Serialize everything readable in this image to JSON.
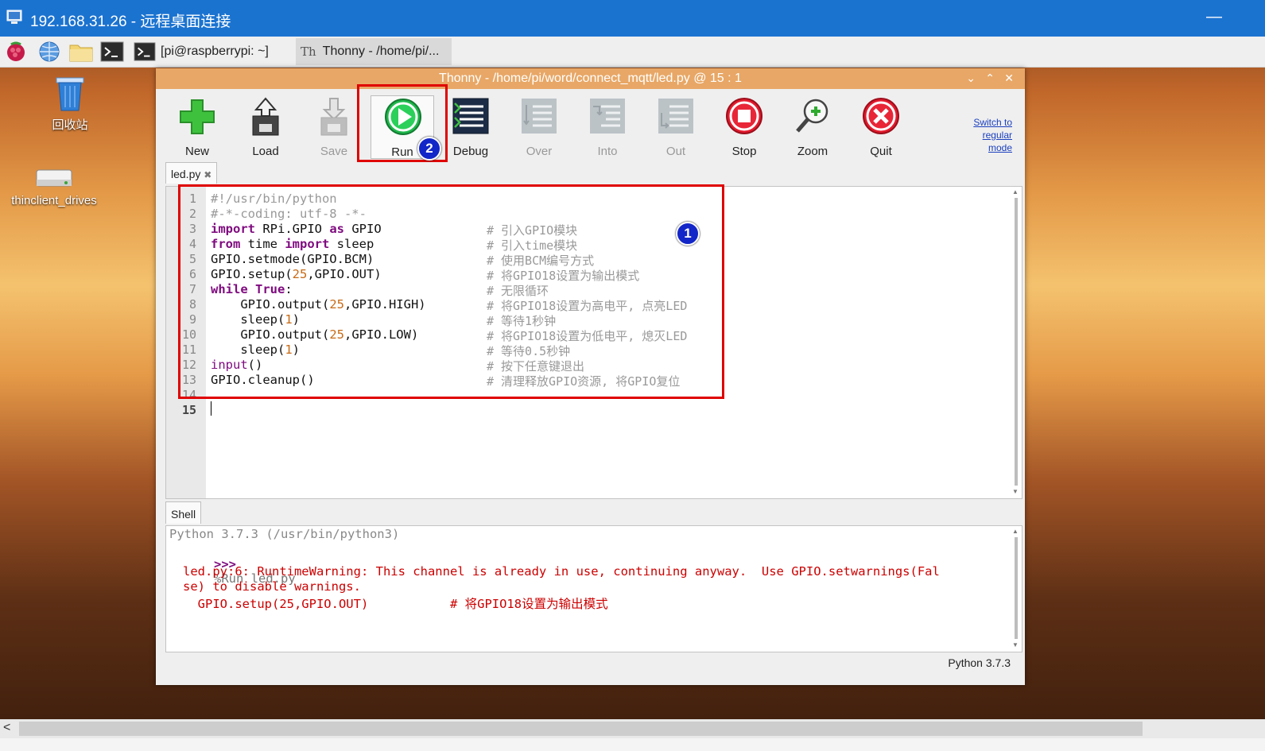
{
  "remote_window": {
    "title": "192.168.31.26 - 远程桌面连接",
    "minimize": "—"
  },
  "taskbar": {
    "terminal_task": "[pi@raspberrypi: ~]",
    "thonny_task": "Thonny  -  /home/pi/...",
    "icons": [
      "raspberry-menu-icon",
      "browser-icon",
      "file-manager-icon",
      "terminal-icon"
    ]
  },
  "desktop": {
    "icons": [
      {
        "name": "trash-icon",
        "label": "回收站"
      },
      {
        "name": "drive-icon",
        "label": "thinclient_drives"
      }
    ]
  },
  "thonny": {
    "title": "Thonny  -  /home/pi/word/connect_mqtt/led.py  @  15 : 1",
    "window_controls": [
      "⌄",
      "⌃",
      "✕"
    ],
    "toolbar": [
      {
        "id": "new",
        "label": "New",
        "enabled": true
      },
      {
        "id": "load",
        "label": "Load",
        "enabled": true
      },
      {
        "id": "save",
        "label": "Save",
        "enabled": false
      },
      {
        "id": "run",
        "label": "Run",
        "enabled": true
      },
      {
        "id": "debug",
        "label": "Debug",
        "enabled": true
      },
      {
        "id": "over",
        "label": "Over",
        "enabled": false
      },
      {
        "id": "into",
        "label": "Into",
        "enabled": false
      },
      {
        "id": "out",
        "label": "Out",
        "enabled": false
      },
      {
        "id": "stop",
        "label": "Stop",
        "enabled": true
      },
      {
        "id": "zoom",
        "label": "Zoom",
        "enabled": true
      },
      {
        "id": "quit",
        "label": "Quit",
        "enabled": true
      }
    ],
    "switch_mode": [
      "Switch to",
      "regular",
      "mode"
    ],
    "editor_tab": "led.py",
    "editor_tab_close": "✖",
    "line_numbers": [
      "1",
      "2",
      "3",
      "4",
      "5",
      "6",
      "7",
      "8",
      "9",
      "10",
      "11",
      "12",
      "13",
      "14",
      "15"
    ],
    "code_comments": [
      "",
      "",
      "# 引入GPIO模块",
      "# 引入time模块",
      "# 使用BCM编号方式",
      "# 将GPIO18设置为输出模式",
      "# 无限循环",
      "# 将GPIO18设置为高电平, 点亮LED",
      "# 等待1秒钟",
      "# 将GPIO18设置为低电平, 熄灭LED",
      "# 等待0.5秒钟",
      "# 按下任意键退出",
      "# 清理释放GPIO资源, 将GPIO复位"
    ],
    "shell_tab": "Shell",
    "shell": {
      "version_line": "Python 3.7.3 (/usr/bin/python3)",
      "prompt": ">>>",
      "command": "%Run led.py",
      "warning_1": "led.py:6: RuntimeWarning: This channel is already in use, continuing anyway.  Use GPIO.setwarnings(Fal",
      "warning_2": "se) to disable warnings.",
      "warning_3": "  GPIO.setup(25,GPIO.OUT)           # 将GPIO18设置为输出模式"
    },
    "status": "Python 3.7.3"
  },
  "annotations": {
    "badge_1": "1",
    "badge_2": "2"
  },
  "colors": {
    "accent_red": "#e00000",
    "badge_blue": "#1326c8",
    "keyword": "#7f0a7f",
    "warning": "#cc0000"
  }
}
